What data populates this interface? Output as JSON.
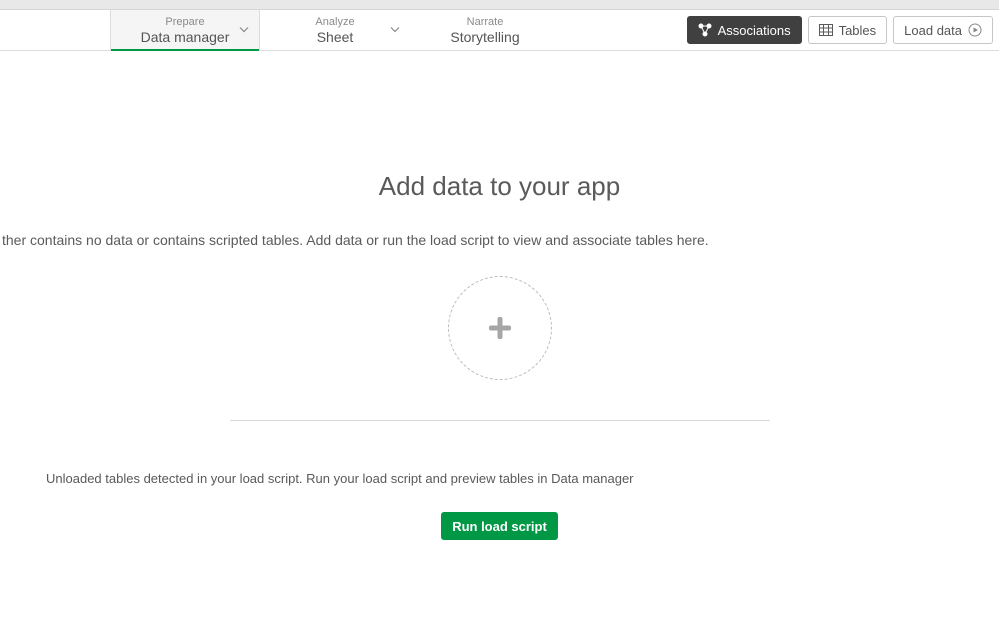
{
  "nav": {
    "tabs": [
      {
        "sup": "Prepare",
        "main": "Data manager",
        "active": true,
        "hasChevron": true
      },
      {
        "sup": "Analyze",
        "main": "Sheet",
        "active": false,
        "hasChevron": true
      },
      {
        "sup": "Narrate",
        "main": "Storytelling",
        "active": false,
        "hasChevron": false
      }
    ]
  },
  "toolbar": {
    "associations": "Associations",
    "tables": "Tables",
    "load_data": "Load data"
  },
  "main": {
    "title": "Add data to your app",
    "subtitle": "ther contains no data or contains scripted tables. Add data or run the load script to view and associate tables here.",
    "unloaded_message": "Unloaded tables detected in your load script. Run your load script and preview tables in Data manager",
    "run_button": "Run load script"
  }
}
